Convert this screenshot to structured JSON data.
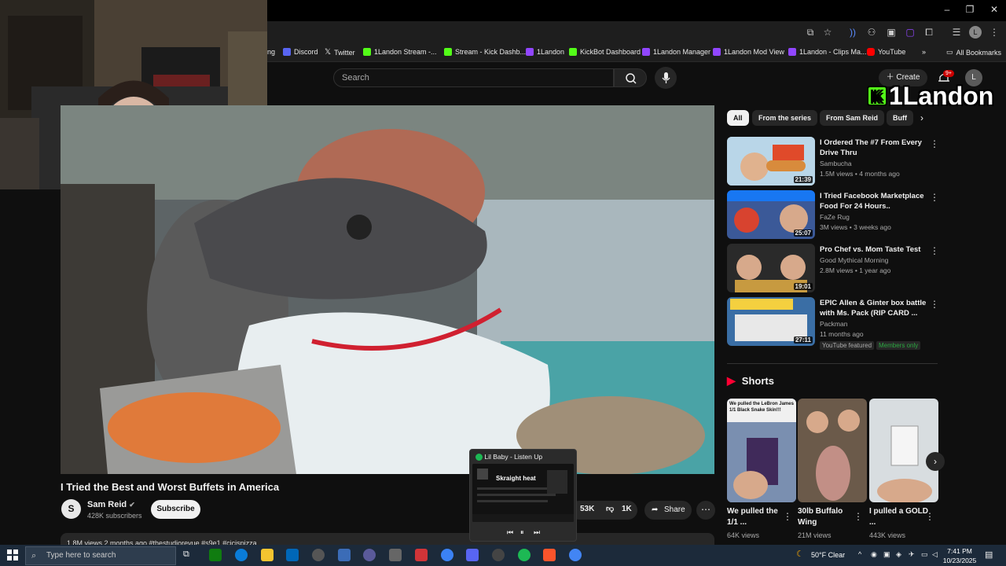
{
  "browser": {
    "window_controls": {
      "minimize": "–",
      "maximize": "❐",
      "close": "✕"
    },
    "bookmarks": [
      {
        "label": "ng",
        "color": "#888"
      },
      {
        "label": "Discord",
        "color": "#5865f2"
      },
      {
        "label": "Twitter",
        "color": "#ffffff"
      },
      {
        "label": "1Landon Stream -...",
        "color": "#53fc18"
      },
      {
        "label": "Stream - Kick Dashb...",
        "color": "#53fc18"
      },
      {
        "label": "1Landon",
        "color": "#9146ff"
      },
      {
        "label": "KickBot Dashboard",
        "color": "#53fc18"
      },
      {
        "label": "1Landon Manager",
        "color": "#9146ff"
      },
      {
        "label": "1Landon Mod View",
        "color": "#9146ff"
      },
      {
        "label": "1Landon - Clips Ma...",
        "color": "#9146ff"
      },
      {
        "label": "YouTube",
        "color": "#ff0000"
      }
    ],
    "all_bookmarks": "All Bookmarks",
    "overflow": "»"
  },
  "youtube": {
    "search": {
      "placeholder": "Search"
    },
    "create_label": "Create",
    "notification_count": "9+",
    "avatar_letter": "L",
    "watermark": {
      "k": "K",
      "text": "1Landon"
    },
    "video": {
      "title": "I Tried the Best and Worst Buffets in America",
      "channel": "Sam Reid",
      "channel_initial": "S",
      "subscribers": "428K subscribers",
      "subscribe_label": "Subscribe",
      "likes": "53K",
      "dislikes": "1K",
      "share_label": "Share",
      "description_meta": "1.8M views  2 months ago  #thestudiorevue #s9e1 #cicispizza"
    },
    "chips": [
      {
        "label": "All",
        "active": true
      },
      {
        "label": "From the series",
        "active": false
      },
      {
        "label": "From Sam Reid",
        "active": false
      },
      {
        "label": "Buff",
        "active": false
      }
    ],
    "recommended": [
      {
        "title": "I Ordered The #7 From Every Drive Thru",
        "channel": "Sambucha",
        "meta": "1.5M views • 4 months ago",
        "duration": "21:39",
        "thumb_color": "#b9d6e8"
      },
      {
        "title": "I Tried Facebook Marketplace Food For 24 Hours..",
        "channel": "FaZe Rug",
        "meta": "3M views • 3 weeks ago",
        "duration": "25:07",
        "thumb_color": "#e04a3a"
      },
      {
        "title": "Pro Chef vs. Mom Taste Test",
        "channel": "Good Mythical Morning",
        "meta": "2.8M views • 1 year ago",
        "duration": "19:01",
        "thumb_color": "#c79a40"
      },
      {
        "title": "EPIC Allen & Ginter box battle with Ms. Pack (RIP CARD ...",
        "channel": "Packman",
        "meta": "11 months ago",
        "duration": "27:11",
        "thumb_color": "#3a6ea5",
        "tags": [
          "YouTube featured",
          "Members only"
        ]
      }
    ],
    "shorts_heading": "Shorts",
    "shorts": [
      {
        "title": "We pulled the 1/1 ...",
        "views": "64K views",
        "overlay": "We pulled the LeBron James 1/1 Black Snake Skin!!!",
        "color": "#7a8fb0"
      },
      {
        "title": "30lb Buffalo Wing",
        "views": "21M views",
        "overlay": "",
        "color": "#c9a58a"
      },
      {
        "title": "I pulled a GOLD ...",
        "views": "443K views",
        "overlay": "",
        "color": "#d8dde0"
      }
    ]
  },
  "mini_player": {
    "title": "Lil Baby - Listen Up",
    "screen_text": "Skraight heat"
  },
  "taskbar": {
    "search_placeholder": "Type here to search",
    "weather": "50°F  Clear",
    "time": "7:41 PM",
    "date": "10/23/2025",
    "app_colors": [
      "#0078d4",
      "#107c10",
      "#0a7cd8",
      "#f4c430",
      "#0067b8",
      "#444",
      "#3b6cb7",
      "#555",
      "#5a5a9a",
      "#d13438",
      "#3b82f6",
      "#5865f2",
      "#444",
      "#1db954",
      "#fb542b",
      "#4285f4"
    ]
  }
}
